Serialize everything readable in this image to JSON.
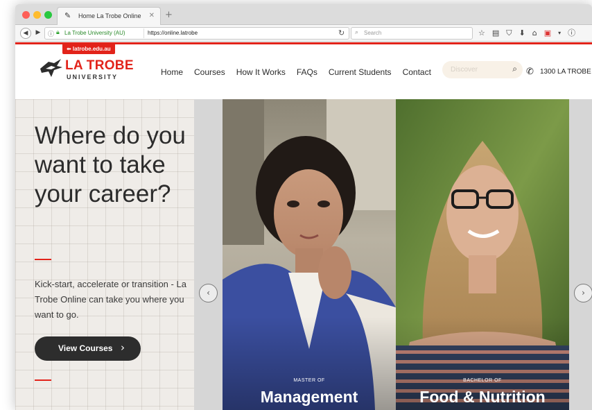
{
  "browser": {
    "tab_title": "Home La Trobe Online",
    "site_identity": "La Trobe University (AU)",
    "url": "https://online.latrobe",
    "search_placeholder": "Search"
  },
  "site": {
    "parent_link": "⬅ latrobe.edu.au",
    "logo": {
      "name": "LA TROBE",
      "sub": "UNIVERSITY"
    },
    "nav": [
      "Home",
      "Courses",
      "How It Works",
      "FAQs",
      "Current Students",
      "Contact"
    ],
    "search_placeholder": "Discover",
    "phone": "1300 LA TROBE"
  },
  "hero": {
    "title": "Where do you want to take your career?",
    "description": "Kick-start, accelerate or transition - La Trobe Online can take you where you want to go.",
    "cta_label": "View Courses",
    "panels": [
      {
        "tag": "MASTER OF",
        "name": "Management"
      },
      {
        "tag": "BACHELOR OF",
        "name": "Food & Nutrition"
      }
    ]
  },
  "colors": {
    "brand_red": "#e2231a",
    "cta_dark": "#2d2d2d",
    "hero_bg": "#efece8"
  },
  "icons": [
    "back-icon",
    "forward-icon",
    "info-icon",
    "lock-icon",
    "reload-icon",
    "search-icon",
    "bookmark-star-icon",
    "reading-list-icon",
    "pocket-icon",
    "download-icon",
    "home-icon",
    "extension-icon",
    "phone-icon",
    "chevron-left-icon",
    "chevron-right-icon"
  ]
}
